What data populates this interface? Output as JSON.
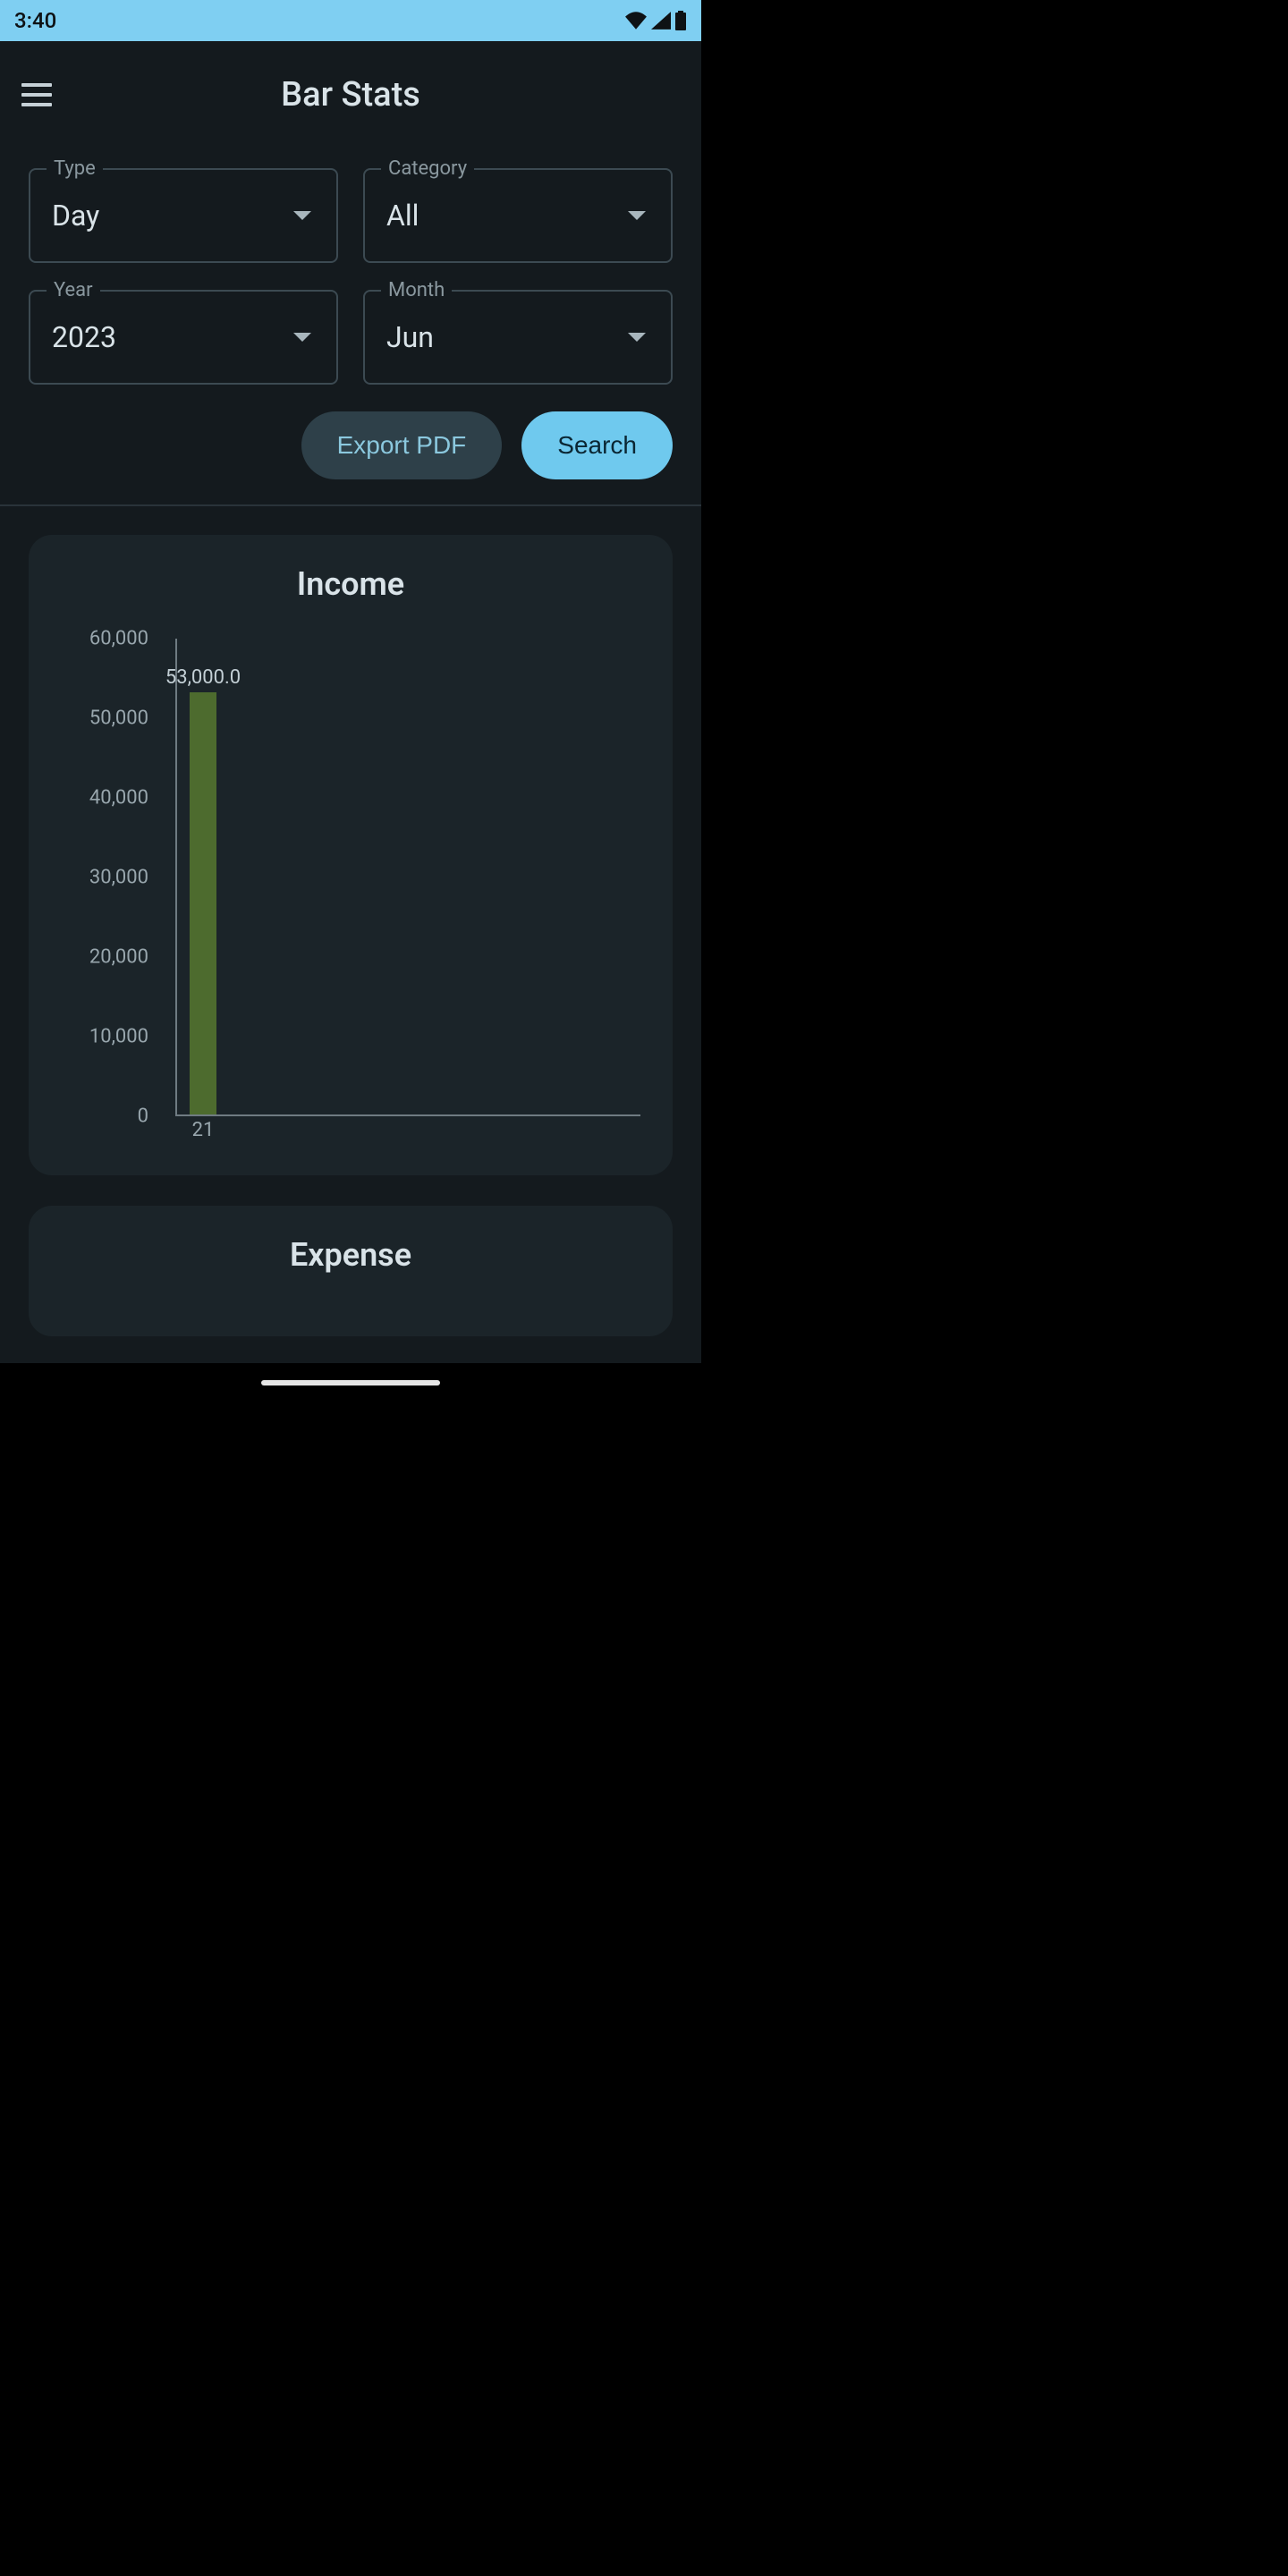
{
  "status": {
    "time": "3:40"
  },
  "header": {
    "title": "Bar Stats"
  },
  "filters": {
    "type": {
      "label": "Type",
      "value": "Day"
    },
    "category": {
      "label": "Category",
      "value": "All"
    },
    "year": {
      "label": "Year",
      "value": "2023"
    },
    "month": {
      "label": "Month",
      "value": "Jun"
    }
  },
  "actions": {
    "export_pdf": "Export PDF",
    "search": "Search"
  },
  "cards": {
    "income": {
      "title": "Income"
    },
    "expense": {
      "title": "Expense"
    }
  },
  "chart_data": {
    "type": "bar",
    "title": "Income",
    "categories": [
      "21"
    ],
    "values": [
      53000.0
    ],
    "data_labels": [
      "53,000.0"
    ],
    "ylim": [
      0,
      60000
    ],
    "yticks": [
      0,
      10000,
      20000,
      30000,
      40000,
      50000,
      60000
    ],
    "ytick_labels": [
      "0",
      "10,000",
      "20,000",
      "30,000",
      "40,000",
      "50,000",
      "60,000"
    ],
    "xlabel": "",
    "ylabel": ""
  }
}
